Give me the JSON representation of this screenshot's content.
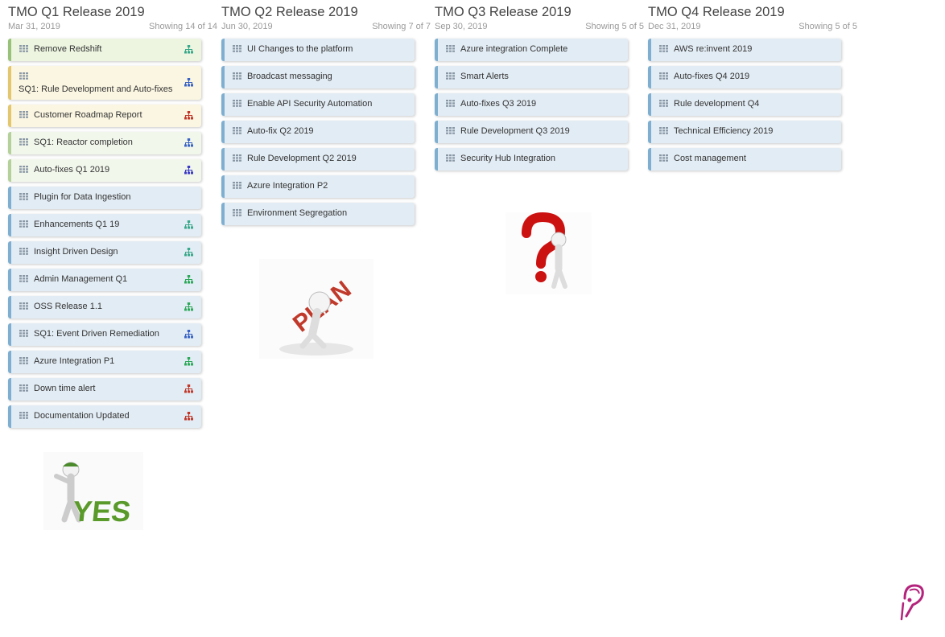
{
  "columns": [
    {
      "title": "TMO Q1 Release 2019",
      "date": "Mar 31, 2019",
      "count": "Showing 14 of 14",
      "cards": [
        {
          "label": "Remove Redshift",
          "style": "green",
          "hier": "#3aa88a"
        },
        {
          "label": "SQ1: Rule Development and Auto-fixes",
          "style": "yellow tall",
          "hier": "#3b63c4"
        },
        {
          "label": "Customer Roadmap Report",
          "style": "yellow",
          "hier": "#c0392b"
        },
        {
          "label": "SQ1: Reactor completion",
          "style": "lightgreen",
          "hier": "#3b63c4"
        },
        {
          "label": "Auto-fixes Q1 2019",
          "style": "lightgreen",
          "hier": "#3b3bc4"
        },
        {
          "label": "Plugin for Data Ingestion",
          "style": "",
          "hier": ""
        },
        {
          "label": "Enhancements Q1 19",
          "style": "",
          "hier": "#3aa88a"
        },
        {
          "label": "Insight Driven Design",
          "style": "",
          "hier": "#3aa88a"
        },
        {
          "label": "Admin Management Q1",
          "style": "",
          "hier": "#2ea85a"
        },
        {
          "label": "OSS Release 1.1",
          "style": "",
          "hier": "#2ea85a"
        },
        {
          "label": "SQ1: Event Driven Remediation",
          "style": "",
          "hier": "#3b63c4"
        },
        {
          "label": "Azure Integration P1",
          "style": "",
          "hier": "#2ea85a"
        },
        {
          "label": "Down time alert",
          "style": "",
          "hier": "#c0392b"
        },
        {
          "label": "Documentation Updated",
          "style": "",
          "hier": "#c0392b"
        }
      ]
    },
    {
      "title": "TMO Q2 Release 2019",
      "date": "Jun 30, 2019",
      "count": "Showing 7 of 7",
      "cards": [
        {
          "label": "UI Changes to the platform",
          "style": "",
          "hier": ""
        },
        {
          "label": "Broadcast messaging",
          "style": "",
          "hier": ""
        },
        {
          "label": "Enable API Security Automation",
          "style": "",
          "hier": ""
        },
        {
          "label": "Auto-fix Q2 2019",
          "style": "",
          "hier": ""
        },
        {
          "label": "Rule Development Q2 2019",
          "style": "",
          "hier": ""
        },
        {
          "label": "Azure Integration P2",
          "style": "",
          "hier": ""
        },
        {
          "label": "Environment Segregation",
          "style": "",
          "hier": ""
        }
      ]
    },
    {
      "title": "TMO Q3 Release 2019",
      "date": "Sep 30, 2019",
      "count": "Showing 5 of 5",
      "cards": [
        {
          "label": "Azure integration Complete",
          "style": "",
          "hier": ""
        },
        {
          "label": "Smart Alerts",
          "style": "",
          "hier": ""
        },
        {
          "label": "Auto-fixes Q3 2019",
          "style": "",
          "hier": ""
        },
        {
          "label": "Rule Development Q3 2019",
          "style": "",
          "hier": ""
        },
        {
          "label": "Security Hub Integration",
          "style": "",
          "hier": ""
        }
      ]
    },
    {
      "title": "TMO Q4 Release 2019",
      "date": "Dec 31, 2019",
      "count": "Showing 5 of 5",
      "cards": [
        {
          "label": "AWS re:invent 2019",
          "style": "",
          "hier": ""
        },
        {
          "label": "Auto-fixes Q4 2019",
          "style": "",
          "hier": ""
        },
        {
          "label": "Rule development Q4",
          "style": "",
          "hier": ""
        },
        {
          "label": "Technical Efficiency 2019",
          "style": "",
          "hier": ""
        },
        {
          "label": "Cost management",
          "style": "",
          "hier": ""
        }
      ]
    }
  ],
  "images": {
    "yes": {
      "text": "YES",
      "color": "#5a9a2a"
    },
    "plan": {
      "text": "PLAN",
      "color": "#c0392b"
    },
    "question": {
      "color": "#cc1111"
    }
  },
  "icons": {
    "grip": "grid-icon",
    "hierarchy": "hierarchy-icon",
    "help": "help-icon"
  },
  "colors": {
    "help": "#b4237c"
  }
}
